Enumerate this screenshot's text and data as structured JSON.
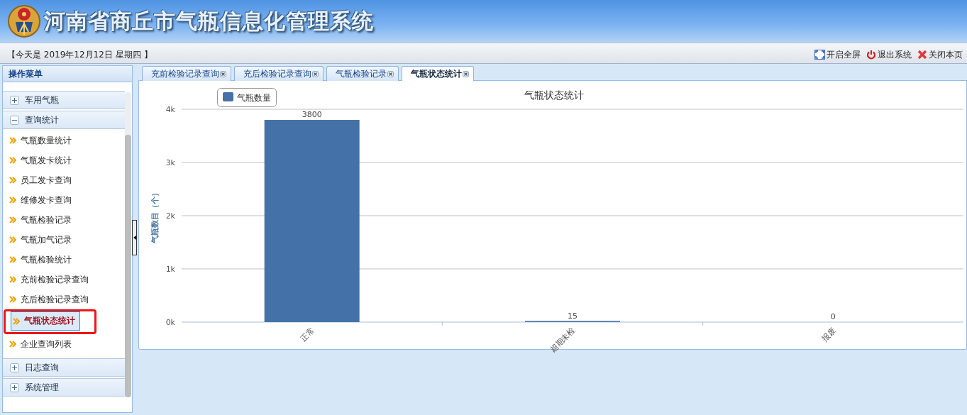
{
  "header": {
    "title": "河南省商丘市气瓶信息化管理系统"
  },
  "date_bar": {
    "date_text": "【今天是 2019年12月12日 星期四 】",
    "actions": [
      {
        "kind": "fullscreen",
        "label": "开启全屏"
      },
      {
        "kind": "logout",
        "label": "退出系统"
      },
      {
        "kind": "close",
        "label": "关闭本页"
      }
    ]
  },
  "sidebar": {
    "title": "操作菜单",
    "groups": [
      {
        "label": "车用气瓶",
        "expanded": false
      },
      {
        "label": "查询统计",
        "expanded": true,
        "items": [
          {
            "label": "气瓶数量统计",
            "selected": false
          },
          {
            "label": "气瓶发卡统计",
            "selected": false
          },
          {
            "label": "员工发卡查询",
            "selected": false
          },
          {
            "label": "维修发卡查询",
            "selected": false
          },
          {
            "label": "气瓶检验记录",
            "selected": false
          },
          {
            "label": "气瓶加气记录",
            "selected": false
          },
          {
            "label": "气瓶检验统计",
            "selected": false
          },
          {
            "label": "充前检验记录查询",
            "selected": false
          },
          {
            "label": "充后检验记录查询",
            "selected": false
          },
          {
            "label": "气瓶状态统计",
            "selected": true
          },
          {
            "label": "企业查询列表",
            "selected": false
          }
        ]
      },
      {
        "label": "日志查询",
        "expanded": false
      },
      {
        "label": "系统管理",
        "expanded": false
      }
    ]
  },
  "tabs": [
    {
      "label": "充前检验记录查询",
      "selected": false
    },
    {
      "label": "充后检验记录查询",
      "selected": false
    },
    {
      "label": "气瓶检验记录",
      "selected": false
    },
    {
      "label": "气瓶状态统计",
      "selected": true
    }
  ],
  "chart": {
    "chart_data": {
      "type": "bar",
      "title": "气瓶状态统计",
      "ylabel": "气瓶数目（个）",
      "categories": [
        "正常",
        "超期未检",
        "报废"
      ],
      "series": [
        {
          "name": "气瓶数量",
          "color": "#4472a8",
          "values": [
            3800,
            15,
            0
          ]
        }
      ],
      "ylim": [
        0,
        4000
      ],
      "yticks": [
        {
          "value": 0,
          "label": "0k"
        },
        {
          "value": 1000,
          "label": "1k"
        },
        {
          "value": 2000,
          "label": "2k"
        },
        {
          "value": 3000,
          "label": "3k"
        },
        {
          "value": 4000,
          "label": "4k"
        }
      ],
      "data_labels": true,
      "grid": true
    }
  }
}
